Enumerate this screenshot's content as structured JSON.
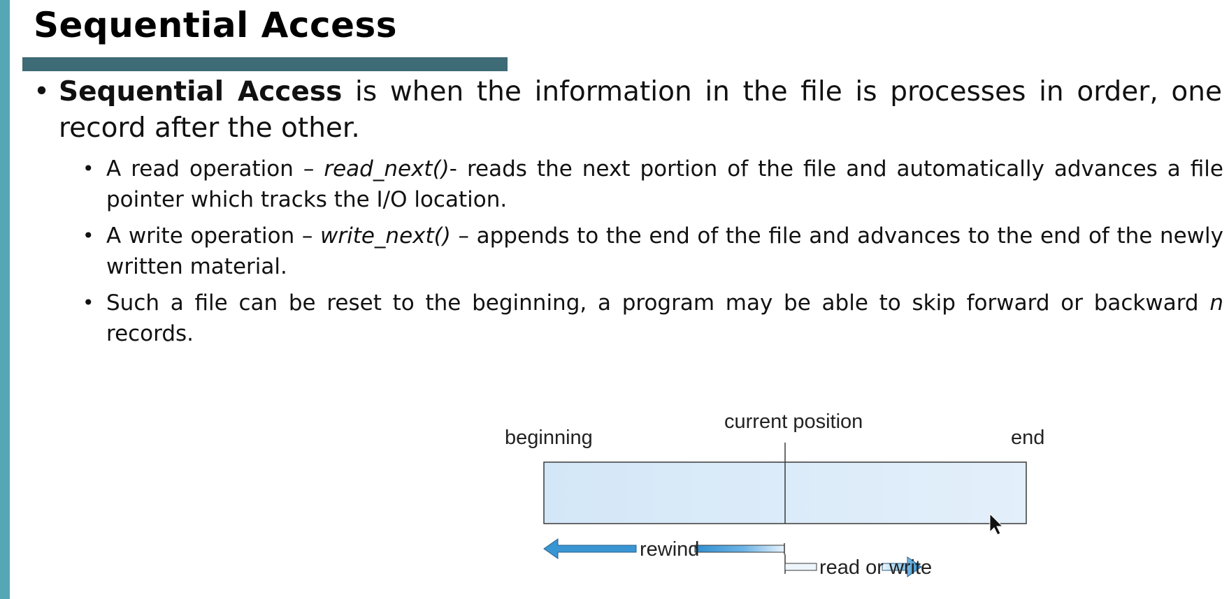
{
  "slide": {
    "title": "Sequential Access",
    "bullet1": {
      "bold": "Sequential Access",
      "rest": " is when the information in the file is processes in order, one record after the other."
    },
    "sub1": {
      "pre": "A read operation – ",
      "italic": "read_next()",
      "post": "- reads the next portion of the file and automatically advances a file pointer which tracks the I/O location."
    },
    "sub2": {
      "pre": "A write operation – ",
      "italic": "write_next()",
      "post": " – appends to the end of the file and advances to the end of the newly written material."
    },
    "sub3": {
      "pre": "Such a file can be reset to the beginning, a program may be able to skip forward or backward ",
      "italic": "n",
      "post": " records."
    }
  },
  "diagram": {
    "label_beginning": "beginning",
    "label_current": "current position",
    "label_end": "end",
    "label_rewind": "rewind",
    "label_rw": "read or write",
    "colors": {
      "file_fill": "#d8e9f8",
      "arrow_blue": "#3a95d3",
      "outline": "#333333"
    }
  }
}
